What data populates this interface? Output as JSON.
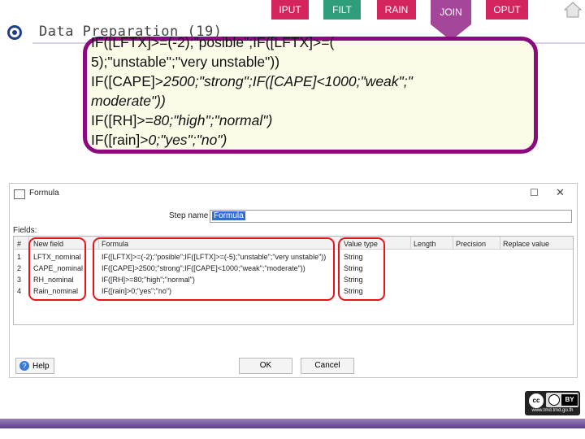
{
  "nav": {
    "tabs": [
      {
        "label": "IPUT",
        "color": "#d4245e"
      },
      {
        "label": "FILT",
        "color": "#2f9d7a"
      },
      {
        "label": "RAIN",
        "color": "#d4245e"
      },
      {
        "label": "JOIN",
        "color": "#a4469a",
        "active": true
      },
      {
        "label": "OPUT",
        "color": "#d4245e"
      }
    ],
    "home_icon": "home-icon"
  },
  "header": {
    "title": "Data Preparation (19)",
    "logo_icon": "logo-icon"
  },
  "callout": {
    "border_color": "#8b0b7f",
    "lines": [
      "IF([LFTX]>=(-2);\"posible\";IF([LFTX]>=(",
      "5);\"unstable\";\"very unstable\"))",
      "IF([CAPE]>",
      "2500;\"strong\";IF([CAPE]<1000;\"weak\";\"",
      "moderate\"))",
      "IF([RH]>=",
      "80;\"high\";\"normal\")",
      "IF([rain]>",
      "0;\"yes\";\"no\")"
    ]
  },
  "dialog": {
    "title": "Formula",
    "step_name_label": "Step name",
    "step_name_value": "Formula",
    "fields_label": "Fields:",
    "columns": [
      "#",
      "New field",
      "Formula",
      "Value type",
      "Length",
      "Precision",
      "Replace value"
    ],
    "rows": [
      {
        "num": "1",
        "field": "LFTX_nominal",
        "formula": "IF([LFTX]>=(-2);\"posible\";IF([LFTX]>=(-5);\"unstable\";\"very unstable\"))",
        "type": "String"
      },
      {
        "num": "2",
        "field": "CAPE_nominal",
        "formula": "IF([CAPE]>2500;\"strong\";IF([CAPE]<1000;\"weak\";\"moderate\"))",
        "type": "String"
      },
      {
        "num": "3",
        "field": "RH_nominal",
        "formula": "IF([RH]>=80;\"high\";\"normal\")",
        "type": "String"
      },
      {
        "num": "4",
        "field": "Rain_nominal",
        "formula": "IF([rain]>0;\"yes\";\"no\")",
        "type": "String"
      }
    ],
    "help_label": "Help",
    "ok_label": "OK",
    "cancel_label": "Cancel",
    "highlight_color": "#e8141c"
  },
  "footer": {
    "cc_label": "cc",
    "by_label": "BY",
    "url": "www.tmd.tmd.go.th"
  }
}
